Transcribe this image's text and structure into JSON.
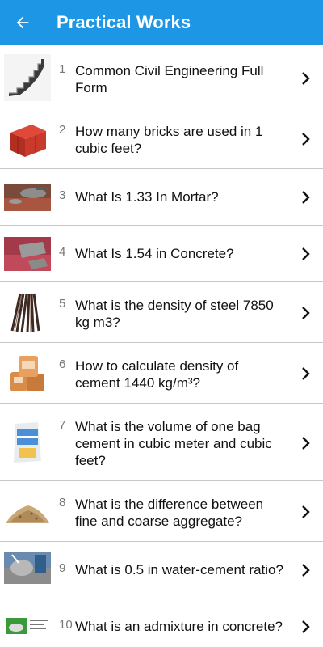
{
  "appbar": {
    "title": "Practical Works",
    "back_icon": "arrow-back-icon",
    "color": "#1e96e6"
  },
  "items": [
    {
      "num": "1",
      "title": "Common Civil Engineering Full Form",
      "icon": "staircase-thumbnail"
    },
    {
      "num": "2",
      "title": "How many bricks are used in 1 cubic feet?",
      "icon": "bricks-thumbnail"
    },
    {
      "num": "3",
      "title": "What Is 1.33 In Mortar?",
      "icon": "mortar-thumbnail"
    },
    {
      "num": "4",
      "title": "What Is 1.54 in Concrete?",
      "icon": "concrete-thumbnail"
    },
    {
      "num": "5",
      "title": "What is the density of steel 7850 kg m3?",
      "icon": "steel-bars-thumbnail"
    },
    {
      "num": "6",
      "title": "How to calculate density of cement 1440 kg/m³?",
      "icon": "cement-bags-thumbnail"
    },
    {
      "num": "7",
      "title": "What is the volume of one bag cement in cubic meter and cubic feet?",
      "icon": "cement-bag-thumbnail"
    },
    {
      "num": "8",
      "title": "What is the difference between fine and coarse aggregate?",
      "icon": "aggregate-pile-thumbnail"
    },
    {
      "num": "9",
      "title": "What is 0.5 in water-cement ratio?",
      "icon": "water-cement-thumbnail"
    },
    {
      "num": "10",
      "title": "What is an admixture in concrete?",
      "icon": "admixture-thumbnail"
    }
  ]
}
